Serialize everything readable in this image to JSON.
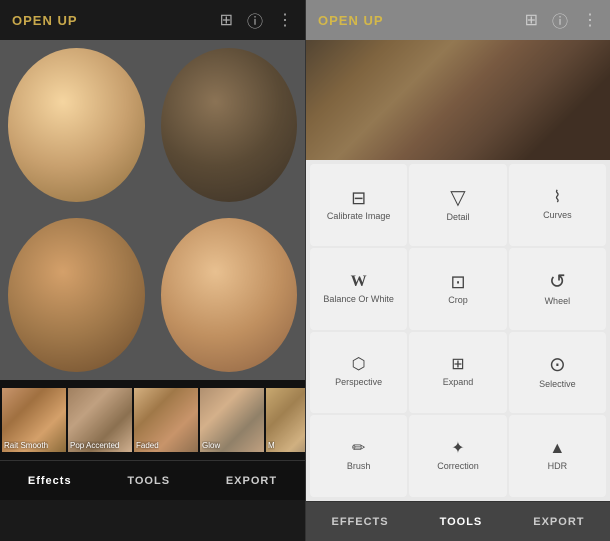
{
  "left": {
    "app_title": "OPEN UP",
    "top_icons": [
      "layers",
      "info",
      "more"
    ],
    "thumbnails": [
      {
        "label": "Rait Smooth"
      },
      {
        "label": "Pop Accented"
      },
      {
        "label": "Faded"
      },
      {
        "label": "Glow"
      },
      {
        "label": "M"
      }
    ],
    "bottom_nav": [
      {
        "label": "Effects",
        "active": true
      },
      {
        "label": "TOOLS",
        "active": false
      },
      {
        "label": "EXPORT",
        "active": false
      }
    ]
  },
  "right": {
    "app_title": "OPEN UP",
    "top_icons": [
      "layers",
      "info",
      "more"
    ],
    "tools": [
      {
        "icon": "⊞",
        "label": "Calibrate Image",
        "unicode": "≡"
      },
      {
        "icon": "▽",
        "label": "Detail",
        "unicode": "▽"
      },
      {
        "icon": "⊡",
        "label": "Curves",
        "unicode": "⌇"
      },
      {
        "icon": "W",
        "label": "Balance Or White",
        "unicode": "W"
      },
      {
        "icon": "⊠",
        "label": "Crop",
        "unicode": "⊡"
      },
      {
        "icon": "↺",
        "label": "Wheel",
        "unicode": "↺"
      },
      {
        "icon": "⊟",
        "label": "Perspective",
        "unicode": "⊟"
      },
      {
        "icon": "⊞",
        "label": "Expand",
        "unicode": "⊞"
      },
      {
        "icon": "⊙",
        "label": "Selective",
        "unicode": "⊙"
      },
      {
        "icon": "✏",
        "label": "Brush",
        "unicode": "✏"
      },
      {
        "icon": "✦",
        "label": "Correction",
        "unicode": "✦"
      },
      {
        "icon": "▲",
        "label": "HDR",
        "unicode": "▲"
      }
    ],
    "bottom_nav": [
      {
        "label": "EFFECTS",
        "active": false
      },
      {
        "label": "TOOLS",
        "active": true
      },
      {
        "label": "EXPORT",
        "active": false
      }
    ]
  }
}
